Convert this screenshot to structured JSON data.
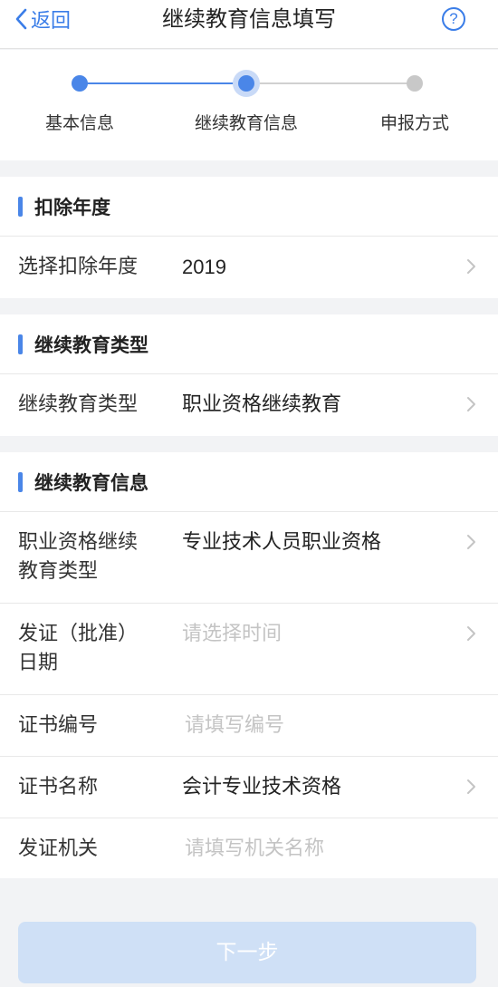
{
  "colors": {
    "accent": "#4a86e8",
    "step_inactive": "#c8c8c8",
    "page_bg": "#f2f3f5",
    "button_disabled": "#cfe0f6"
  },
  "nav": {
    "back_label": "返回",
    "title": "继续教育信息填写",
    "help_label": "?",
    "back_icon": "chevron-left-icon",
    "help_icon": "question-circle-icon"
  },
  "steps": [
    {
      "label": "基本信息",
      "state": "done"
    },
    {
      "label": "继续教育信息",
      "state": "current"
    },
    {
      "label": "申报方式",
      "state": "todo"
    }
  ],
  "sections": {
    "year": {
      "title": "扣除年度",
      "rows": [
        {
          "label": "选择扣除年度",
          "value": "2019"
        }
      ]
    },
    "type": {
      "title": "继续教育类型",
      "rows": [
        {
          "label": "继续教育类型",
          "value": "职业资格继续教育"
        }
      ]
    },
    "info": {
      "title": "继续教育信息",
      "rows": [
        {
          "label_line1": "职业资格继续",
          "label_line2": "教育类型",
          "value": "专业技术人员职业资格"
        },
        {
          "label_line1": "发证（批准）",
          "label_line2": "日期",
          "placeholder": "请选择时间"
        },
        {
          "label": "证书编号",
          "placeholder": "请填写编号"
        },
        {
          "label": "证书名称",
          "value": "会计专业技术资格"
        },
        {
          "label": "发证机关",
          "placeholder": "请填写机关名称"
        }
      ]
    }
  },
  "footer": {
    "next_label": "下一步"
  }
}
